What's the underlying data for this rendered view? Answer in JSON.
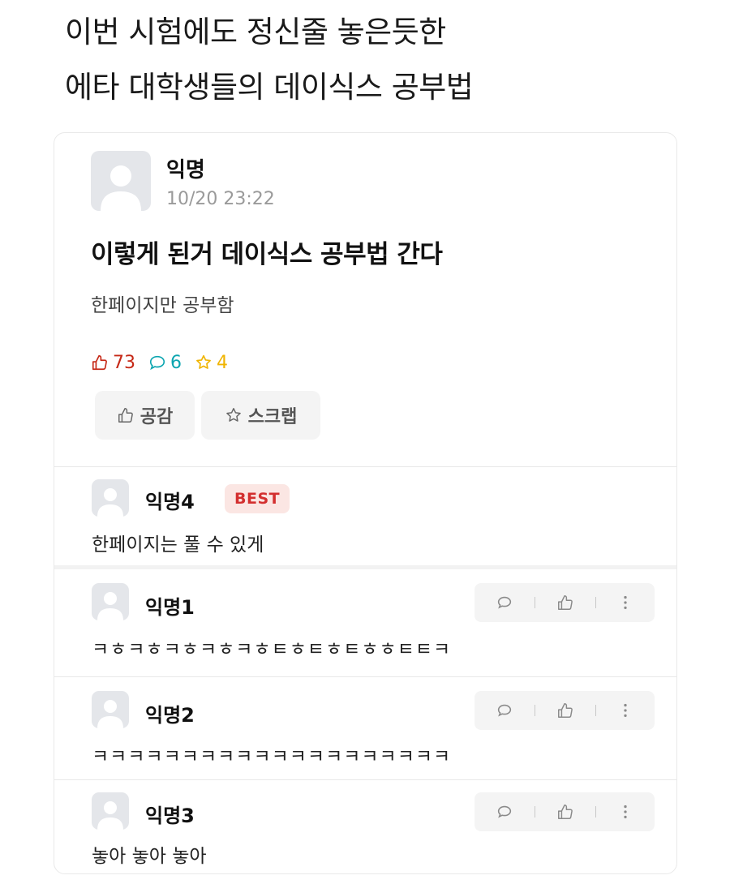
{
  "headline": {
    "line1": "이번 시험에도 정신줄 놓은듯한",
    "line2": "에타 대학생들의 데이식스 공부법"
  },
  "post": {
    "author": "익명",
    "timestamp": "10/20 23:22",
    "title": "이렇게 된거 데이식스 공부법 간다",
    "body": "한페이지만 공부함",
    "likes": "73",
    "comments": "6",
    "scraps": "4",
    "like_button": "공감",
    "scrap_button": "스크랩"
  },
  "best_comment": {
    "author": "익명4",
    "badge": "BEST",
    "text": "한페이지는 풀 수 있게"
  },
  "comments": [
    {
      "author": "익명1",
      "text": "ㅋㅎㅋㅎㅋㅎㅋㅎㅋㅎㅌㅎㅌㅎㅌㅎㅎㅌㅌㅋ"
    },
    {
      "author": "익명2",
      "text": "ㅋㅋㅋㅋㅋㅋㅋㅋㅋㅋㅋㅋㅋㅋㅋㅋㅋㅋㅋㅋ"
    },
    {
      "author": "익명3",
      "text": "놓아 놓아 놓아"
    }
  ],
  "icons": {
    "avatar": "anonymous-avatar-icon",
    "like": "thumbs-up-icon",
    "comment": "comment-bubble-icon",
    "scrap": "star-icon",
    "more": "more-vertical-icon"
  },
  "colors": {
    "like": "#c62917",
    "comment": "#0ca5b0",
    "scrap": "#f0b400",
    "best_bg": "#fbe6e3",
    "best_text": "#d32f2f"
  }
}
